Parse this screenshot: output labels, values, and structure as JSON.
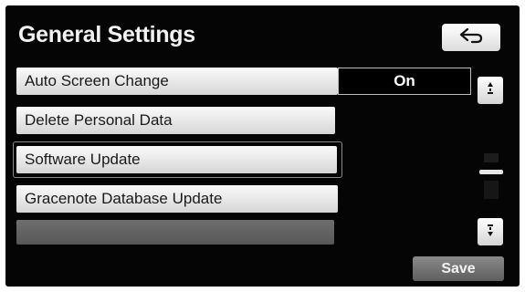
{
  "header": {
    "title": "General Settings",
    "back_icon": "back-arrow-icon"
  },
  "settings": {
    "items": [
      {
        "label": "Auto Screen Change",
        "value": "On"
      },
      {
        "label": "Delete Personal Data"
      },
      {
        "label": "Software Update",
        "selected": true
      },
      {
        "label": "Gracenote Database Update"
      },
      {
        "label": ""
      }
    ]
  },
  "scroll": {
    "up_icon": "scroll-up-icon",
    "down_icon": "scroll-down-icon"
  },
  "footer": {
    "save_label": "Save"
  },
  "colors": {
    "background": "#050505",
    "button_light": "#f0f0f0",
    "button_disabled": "#6e6e6e",
    "text_dark": "#1a1a1a",
    "text_light": "#f2f2f2"
  }
}
